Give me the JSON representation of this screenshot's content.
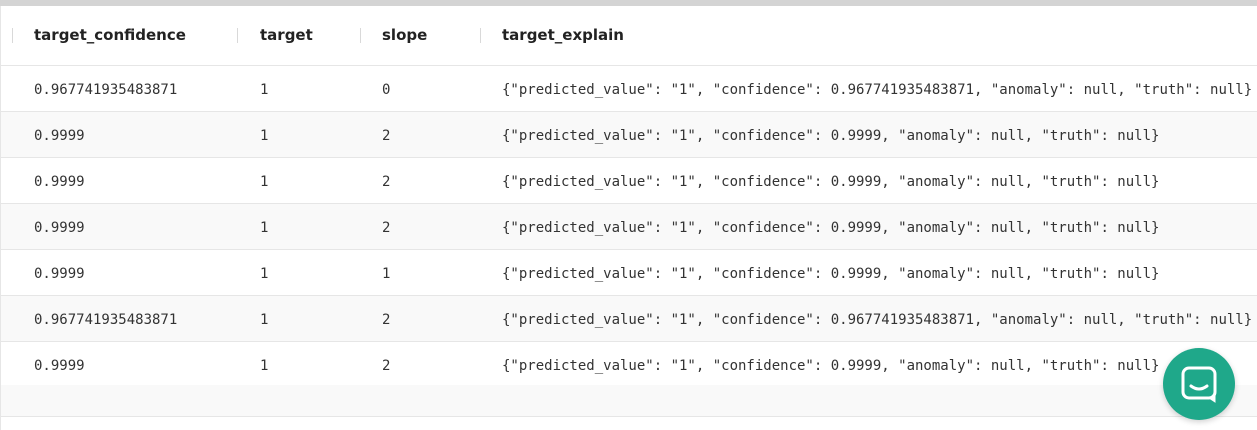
{
  "table": {
    "columns": [
      "target_confidence",
      "target",
      "slope",
      "target_explain"
    ],
    "rows": [
      [
        "0.967741935483871",
        "1",
        "0",
        "{\"predicted_value\": \"1\", \"confidence\": 0.967741935483871, \"anomaly\": null, \"truth\": null}"
      ],
      [
        "0.9999",
        "1",
        "2",
        "{\"predicted_value\": \"1\", \"confidence\": 0.9999, \"anomaly\": null, \"truth\": null}"
      ],
      [
        "0.9999",
        "1",
        "2",
        "{\"predicted_value\": \"1\", \"confidence\": 0.9999, \"anomaly\": null, \"truth\": null}"
      ],
      [
        "0.9999",
        "1",
        "2",
        "{\"predicted_value\": \"1\", \"confidence\": 0.9999, \"anomaly\": null, \"truth\": null}"
      ],
      [
        "0.9999",
        "1",
        "1",
        "{\"predicted_value\": \"1\", \"confidence\": 0.9999, \"anomaly\": null, \"truth\": null}"
      ],
      [
        "0.967741935483871",
        "1",
        "2",
        "{\"predicted_value\": \"1\", \"confidence\": 0.967741935483871, \"anomaly\": null, \"truth\": null}"
      ],
      [
        "0.9999",
        "1",
        "2",
        "{\"predicted_value\": \"1\", \"confidence\": 0.9999, \"anomaly\": null, \"truth\": null}"
      ]
    ]
  },
  "chat_widget": {
    "icon": "chat-icon",
    "color": "#1fa88a"
  }
}
